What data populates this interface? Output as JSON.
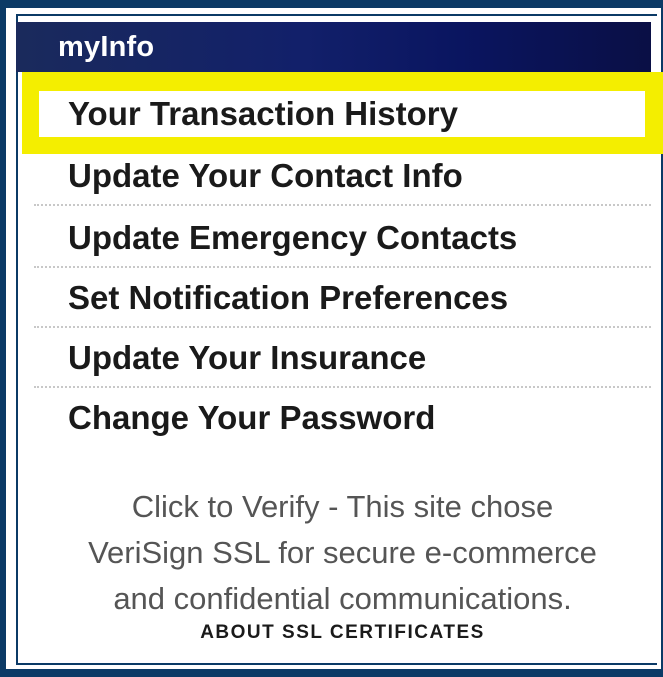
{
  "header": {
    "title": "myInfo"
  },
  "menu": {
    "items": [
      {
        "label": "Your Transaction History",
        "highlighted": true
      },
      {
        "label": "Update Your Contact Info"
      },
      {
        "label": "Update Emergency Contacts"
      },
      {
        "label": "Set Notification Preferences"
      },
      {
        "label": "Update Your Insurance"
      },
      {
        "label": "Change Your Password"
      }
    ]
  },
  "verify": {
    "line1": "Click to Verify - This site chose",
    "line2": "VeriSign SSL for secure e-commerce",
    "line3": "and confidential communications.",
    "about_link": "ABOUT SSL CERTIFICATES"
  },
  "colors": {
    "frame_border": "#0b3a66",
    "header_background": "#0a1560",
    "highlight": "#f4ee00",
    "menu_text": "#1a1a1a",
    "verify_text": "#555555"
  }
}
